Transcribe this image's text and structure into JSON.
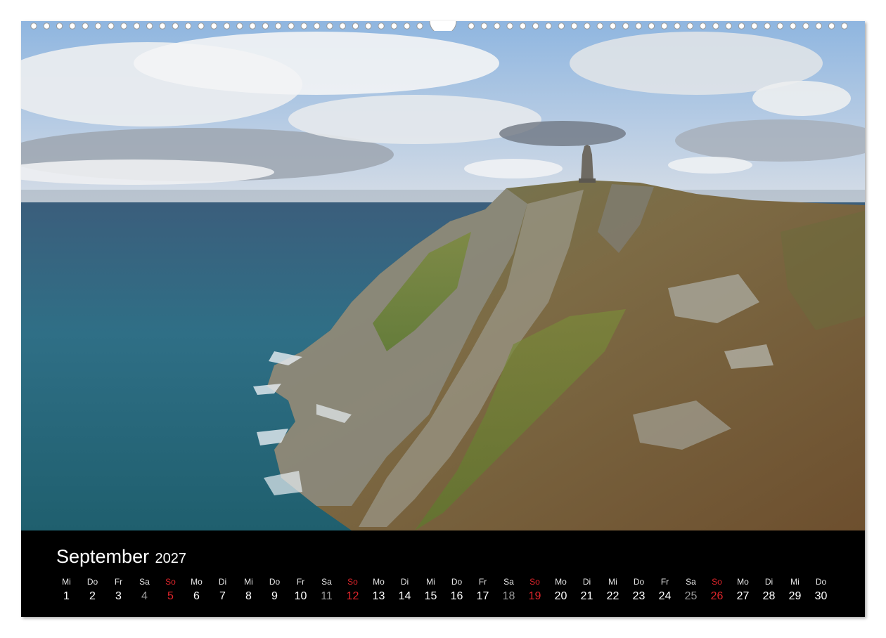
{
  "calendar": {
    "month": "September",
    "year": "2027",
    "days": [
      {
        "wd": "Mi",
        "n": "1"
      },
      {
        "wd": "Do",
        "n": "2"
      },
      {
        "wd": "Fr",
        "n": "3"
      },
      {
        "wd": "Sa",
        "n": "4"
      },
      {
        "wd": "So",
        "n": "5"
      },
      {
        "wd": "Mo",
        "n": "6"
      },
      {
        "wd": "Di",
        "n": "7"
      },
      {
        "wd": "Mi",
        "n": "8"
      },
      {
        "wd": "Do",
        "n": "9"
      },
      {
        "wd": "Fr",
        "n": "10"
      },
      {
        "wd": "Sa",
        "n": "11"
      },
      {
        "wd": "So",
        "n": "12"
      },
      {
        "wd": "Mo",
        "n": "13"
      },
      {
        "wd": "Di",
        "n": "14"
      },
      {
        "wd": "Mi",
        "n": "15"
      },
      {
        "wd": "Do",
        "n": "16"
      },
      {
        "wd": "Fr",
        "n": "17"
      },
      {
        "wd": "Sa",
        "n": "18"
      },
      {
        "wd": "So",
        "n": "19"
      },
      {
        "wd": "Mo",
        "n": "20"
      },
      {
        "wd": "Di",
        "n": "21"
      },
      {
        "wd": "Mi",
        "n": "22"
      },
      {
        "wd": "Do",
        "n": "23"
      },
      {
        "wd": "Fr",
        "n": "24"
      },
      {
        "wd": "Sa",
        "n": "25"
      },
      {
        "wd": "So",
        "n": "26"
      },
      {
        "wd": "Mo",
        "n": "27"
      },
      {
        "wd": "Di",
        "n": "28"
      },
      {
        "wd": "Mi",
        "n": "29"
      },
      {
        "wd": "Do",
        "n": "30"
      }
    ]
  },
  "colors": {
    "sunday": "#e0252b",
    "saturday": "#9a9a9a",
    "bar": "#000000"
  }
}
